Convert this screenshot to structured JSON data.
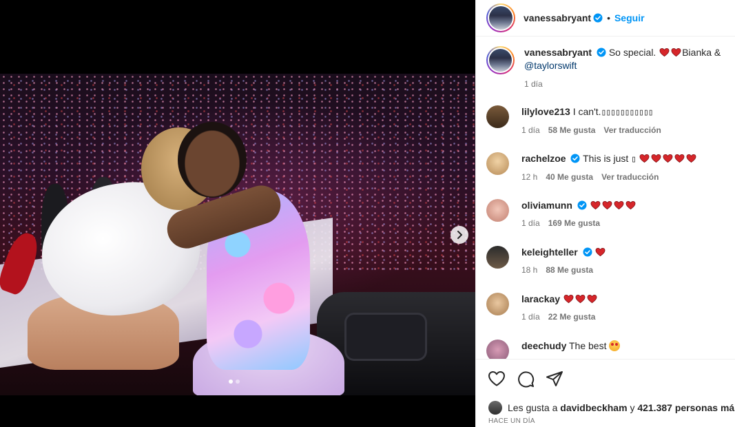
{
  "post": {
    "author": "vanessabryant",
    "separator": "•",
    "follow_label": "Seguir",
    "caption_text": "So special.",
    "caption_after": "Bianka &",
    "caption_mention": "@taylorswift",
    "caption_time": "1 día",
    "carousel": {
      "total_slides": 2,
      "active_index": 0
    }
  },
  "colors": {
    "link_blue": "#0095f6",
    "mention": "#00376b",
    "heart_red": "#d6262a",
    "muted": "#737373",
    "text": "#262626"
  },
  "comments": [
    {
      "username": "lilylove213",
      "text": "I can't.",
      "text_extra": "▯▯▯▯▯▯▯▯▯▯▯",
      "hearts": 0,
      "verified": false,
      "time": "1 día",
      "likes": "58 Me gusta",
      "translate": "Ver traducción"
    },
    {
      "username": "rachelzoe",
      "text": "This is just",
      "text_extra": "▯",
      "hearts": 5,
      "verified": true,
      "time": "12 h",
      "likes": "40 Me gusta",
      "translate": "Ver traducción"
    },
    {
      "username": "oliviamunn",
      "text": "",
      "text_extra": "",
      "hearts": 4,
      "verified": true,
      "time": "1 día",
      "likes": "169 Me gusta",
      "translate": ""
    },
    {
      "username": "keleighteller",
      "text": "",
      "text_extra": "",
      "hearts": 1,
      "verified": true,
      "time": "18 h",
      "likes": "88 Me gusta",
      "translate": ""
    },
    {
      "username": "larackay",
      "text": "",
      "text_extra": "",
      "hearts": 3,
      "verified": false,
      "time": "1 día",
      "likes": "22 Me gusta",
      "translate": ""
    },
    {
      "username": "deechudy",
      "text": "The best",
      "text_extra": "",
      "hearts": 0,
      "verified": false,
      "time": "",
      "likes": "",
      "translate": ""
    }
  ],
  "actions": {
    "icons": [
      "heart-icon",
      "comment-icon",
      "share-icon"
    ],
    "likes_prefix": "Les gusta a",
    "likes_user": "davidbeckham",
    "likes_middle": "y",
    "likes_count": "421.387 personas más",
    "time_ago": "HACE UN DÍA"
  }
}
